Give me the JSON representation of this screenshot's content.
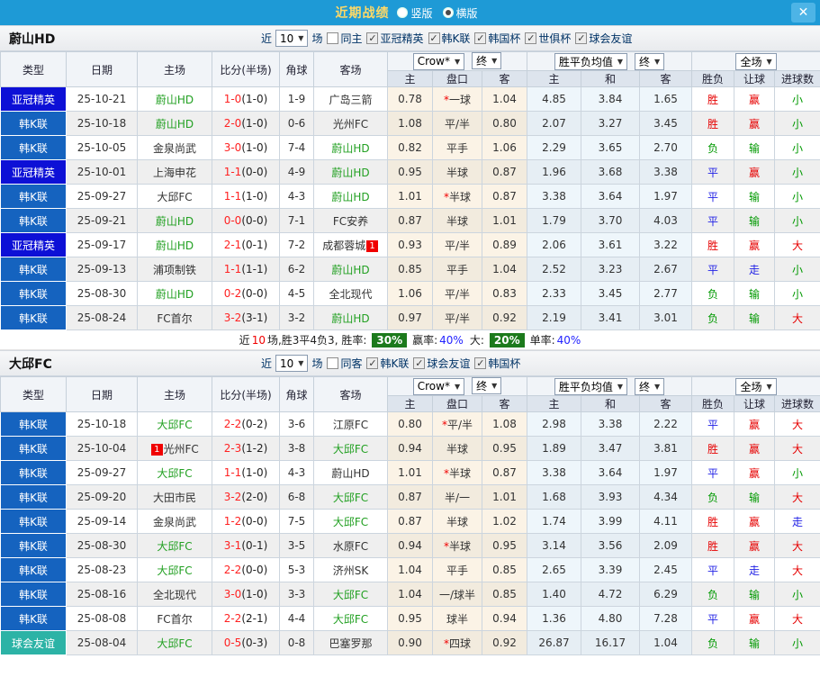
{
  "titlebar": {
    "title": "近期战绩",
    "options": [
      {
        "label": "竖版",
        "selected": false
      },
      {
        "label": "横版",
        "selected": true
      }
    ],
    "close_glyph": "✕"
  },
  "colors": {
    "titlebar_bg": "#1e9ad6",
    "close_btn_bg": "#4db4e6",
    "acl_badge": "#0d10d6",
    "kleague_badge": "#1563bf",
    "friendly_badge": "#2cb3a6",
    "win_red": "#e60000",
    "lose_green": "#009900",
    "draw_blue": "#2222e6",
    "self_team_green": "#22a022",
    "score_red": "#ff2222",
    "summary_badge_green": "#1c7a1c"
  },
  "table_header": {
    "type": "类型",
    "date": "日期",
    "home": "主场",
    "score": "比分(半场)",
    "corner": "角球",
    "away": "客场",
    "odds_source": "Crow*",
    "odds_final": "终",
    "avg_label": "胜平负均值",
    "avg_final": "终",
    "scope": "全场",
    "sub_home": "主",
    "sub_handicap": "盘口",
    "sub_away": "客",
    "sub_avg_home": "主",
    "sub_avg_draw": "和",
    "sub_avg_away": "客",
    "sub_result": "胜负",
    "sub_handicap_result": "让球",
    "sub_goals": "进球数"
  },
  "sections": [
    {
      "team": "蔚山HD",
      "filters": {
        "near": "近",
        "count": "10",
        "games": "场",
        "same": {
          "label": "同主",
          "checked": false
        },
        "leagues": [
          {
            "label": "亚冠精英",
            "checked": true
          },
          {
            "label": "韩K联",
            "checked": true
          },
          {
            "label": "韩国杯",
            "checked": true
          },
          {
            "label": "世俱杯",
            "checked": true
          },
          {
            "label": "球会友谊",
            "checked": true
          }
        ]
      },
      "rows": [
        {
          "league": "亚冠精英",
          "league_color": "acl",
          "date": "25-10-21",
          "home": "蔚山HD",
          "home_is_self": true,
          "home_badge": "",
          "home_badge_pos": "post",
          "score": "1-0",
          "half": "(1-0)",
          "corners": "1-9",
          "away": "广岛三箭",
          "away_is_self": false,
          "away_badge": "",
          "away_badge_pos": "post",
          "odds_home": "0.78",
          "handicap_star": "*",
          "handicap": "一球",
          "odds_away": "1.04",
          "avg_home": "4.85",
          "avg_draw": "3.84",
          "avg_away": "1.65",
          "result": "胜",
          "result_color": "red",
          "handicap_result": "赢",
          "handicap_result_color": "red",
          "goals": "小",
          "goals_color": "green"
        },
        {
          "league": "韩K联",
          "league_color": "kl",
          "date": "25-10-18",
          "home": "蔚山HD",
          "home_is_self": true,
          "home_badge": "",
          "home_badge_pos": "post",
          "score": "2-0",
          "half": "(1-0)",
          "corners": "0-6",
          "away": "光州FC",
          "away_is_self": false,
          "away_badge": "",
          "away_badge_pos": "post",
          "odds_home": "1.08",
          "handicap_star": "",
          "handicap": "平/半",
          "odds_away": "0.80",
          "avg_home": "2.07",
          "avg_draw": "3.27",
          "avg_away": "3.45",
          "result": "胜",
          "result_color": "red",
          "handicap_result": "赢",
          "handicap_result_color": "red",
          "goals": "小",
          "goals_color": "green"
        },
        {
          "league": "韩K联",
          "league_color": "kl",
          "date": "25-10-05",
          "home": "金泉尚武",
          "home_is_self": false,
          "home_badge": "",
          "home_badge_pos": "post",
          "score": "3-0",
          "half": "(1-0)",
          "corners": "7-4",
          "away": "蔚山HD",
          "away_is_self": true,
          "away_badge": "",
          "away_badge_pos": "post",
          "odds_home": "0.82",
          "handicap_star": "",
          "handicap": "平手",
          "odds_away": "1.06",
          "avg_home": "2.29",
          "avg_draw": "3.65",
          "avg_away": "2.70",
          "result": "负",
          "result_color": "green",
          "handicap_result": "输",
          "handicap_result_color": "green",
          "goals": "小",
          "goals_color": "green"
        },
        {
          "league": "亚冠精英",
          "league_color": "acl",
          "date": "25-10-01",
          "home": "上海申花",
          "home_is_self": false,
          "home_badge": "",
          "home_badge_pos": "post",
          "score": "1-1",
          "half": "(0-0)",
          "corners": "4-9",
          "away": "蔚山HD",
          "away_is_self": true,
          "away_badge": "",
          "away_badge_pos": "post",
          "odds_home": "0.95",
          "handicap_star": "",
          "handicap": "半球",
          "odds_away": "0.87",
          "avg_home": "1.96",
          "avg_draw": "3.68",
          "avg_away": "3.38",
          "result": "平",
          "result_color": "blue",
          "handicap_result": "赢",
          "handicap_result_color": "red",
          "goals": "小",
          "goals_color": "green"
        },
        {
          "league": "韩K联",
          "league_color": "kl",
          "date": "25-09-27",
          "home": "大邱FC",
          "home_is_self": false,
          "home_badge": "",
          "home_badge_pos": "post",
          "score": "1-1",
          "half": "(1-0)",
          "corners": "4-3",
          "away": "蔚山HD",
          "away_is_self": true,
          "away_badge": "",
          "away_badge_pos": "post",
          "odds_home": "1.01",
          "handicap_star": "*",
          "handicap": "半球",
          "odds_away": "0.87",
          "avg_home": "3.38",
          "avg_draw": "3.64",
          "avg_away": "1.97",
          "result": "平",
          "result_color": "blue",
          "handicap_result": "输",
          "handicap_result_color": "green",
          "goals": "小",
          "goals_color": "green"
        },
        {
          "league": "韩K联",
          "league_color": "kl",
          "date": "25-09-21",
          "home": "蔚山HD",
          "home_is_self": true,
          "home_badge": "",
          "home_badge_pos": "post",
          "score": "0-0",
          "half": "(0-0)",
          "corners": "7-1",
          "away": "FC安养",
          "away_is_self": false,
          "away_badge": "",
          "away_badge_pos": "post",
          "odds_home": "0.87",
          "handicap_star": "",
          "handicap": "半球",
          "odds_away": "1.01",
          "avg_home": "1.79",
          "avg_draw": "3.70",
          "avg_away": "4.03",
          "result": "平",
          "result_color": "blue",
          "handicap_result": "输",
          "handicap_result_color": "green",
          "goals": "小",
          "goals_color": "green"
        },
        {
          "league": "亚冠精英",
          "league_color": "acl",
          "date": "25-09-17",
          "home": "蔚山HD",
          "home_is_self": true,
          "home_badge": "",
          "home_badge_pos": "post",
          "score": "2-1",
          "half": "(0-1)",
          "corners": "7-2",
          "away": "成都蓉城",
          "away_is_self": false,
          "away_badge": "1",
          "away_badge_pos": "post",
          "odds_home": "0.93",
          "handicap_star": "",
          "handicap": "平/半",
          "odds_away": "0.89",
          "avg_home": "2.06",
          "avg_draw": "3.61",
          "avg_away": "3.22",
          "result": "胜",
          "result_color": "red",
          "handicap_result": "赢",
          "handicap_result_color": "red",
          "goals": "大",
          "goals_color": "red"
        },
        {
          "league": "韩K联",
          "league_color": "kl",
          "date": "25-09-13",
          "home": "浦项制铁",
          "home_is_self": false,
          "home_badge": "",
          "home_badge_pos": "post",
          "score": "1-1",
          "half": "(1-1)",
          "corners": "6-2",
          "away": "蔚山HD",
          "away_is_self": true,
          "away_badge": "",
          "away_badge_pos": "post",
          "odds_home": "0.85",
          "handicap_star": "",
          "handicap": "平手",
          "odds_away": "1.04",
          "avg_home": "2.52",
          "avg_draw": "3.23",
          "avg_away": "2.67",
          "result": "平",
          "result_color": "blue",
          "handicap_result": "走",
          "handicap_result_color": "blue",
          "goals": "小",
          "goals_color": "green"
        },
        {
          "league": "韩K联",
          "league_color": "kl",
          "date": "25-08-30",
          "home": "蔚山HD",
          "home_is_self": true,
          "home_badge": "",
          "home_badge_pos": "post",
          "score": "0-2",
          "half": "(0-0)",
          "corners": "4-5",
          "away": "全北现代",
          "away_is_self": false,
          "away_badge": "",
          "away_badge_pos": "post",
          "odds_home": "1.06",
          "handicap_star": "",
          "handicap": "平/半",
          "odds_away": "0.83",
          "avg_home": "2.33",
          "avg_draw": "3.45",
          "avg_away": "2.77",
          "result": "负",
          "result_color": "green",
          "handicap_result": "输",
          "handicap_result_color": "green",
          "goals": "小",
          "goals_color": "green"
        },
        {
          "league": "韩K联",
          "league_color": "kl",
          "date": "25-08-24",
          "home": "FC首尔",
          "home_is_self": false,
          "home_badge": "",
          "home_badge_pos": "post",
          "score": "3-2",
          "half": "(3-1)",
          "corners": "3-2",
          "away": "蔚山HD",
          "away_is_self": true,
          "away_badge": "",
          "away_badge_pos": "post",
          "odds_home": "0.97",
          "handicap_star": "",
          "handicap": "平/半",
          "odds_away": "0.92",
          "avg_home": "2.19",
          "avg_draw": "3.41",
          "avg_away": "3.01",
          "result": "负",
          "result_color": "green",
          "handicap_result": "输",
          "handicap_result_color": "green",
          "goals": "大",
          "goals_color": "red"
        }
      ],
      "summary": {
        "pre": "近",
        "count": "10",
        "mid": "场,胜3平4负3, 胜率:",
        "rate1": "30%",
        "lab2": "赢率:",
        "rate2": "40%",
        "lab3": "大:",
        "rate3": "20%",
        "lab4": "单率:",
        "rate4": "40%"
      }
    },
    {
      "team": "大邱FC",
      "filters": {
        "near": "近",
        "count": "10",
        "games": "场",
        "same": {
          "label": "同客",
          "checked": false
        },
        "leagues": [
          {
            "label": "韩K联",
            "checked": true
          },
          {
            "label": "球会友谊",
            "checked": true
          },
          {
            "label": "韩国杯",
            "checked": true
          }
        ]
      },
      "rows": [
        {
          "league": "韩K联",
          "league_color": "kl",
          "date": "25-10-18",
          "home": "大邱FC",
          "home_is_self": true,
          "home_badge": "",
          "home_badge_pos": "post",
          "score": "2-2",
          "half": "(0-2)",
          "corners": "3-6",
          "away": "江原FC",
          "away_is_self": false,
          "away_badge": "",
          "away_badge_pos": "post",
          "odds_home": "0.80",
          "handicap_star": "*",
          "handicap": "平/半",
          "odds_away": "1.08",
          "avg_home": "2.98",
          "avg_draw": "3.38",
          "avg_away": "2.22",
          "result": "平",
          "result_color": "blue",
          "handicap_result": "赢",
          "handicap_result_color": "red",
          "goals": "大",
          "goals_color": "red"
        },
        {
          "league": "韩K联",
          "league_color": "kl",
          "date": "25-10-04",
          "home": "光州FC",
          "home_is_self": false,
          "home_badge": "1",
          "home_badge_pos": "pre",
          "score": "2-3",
          "half": "(1-2)",
          "corners": "3-8",
          "away": "大邱FC",
          "away_is_self": true,
          "away_badge": "",
          "away_badge_pos": "post",
          "odds_home": "0.94",
          "handicap_star": "",
          "handicap": "半球",
          "odds_away": "0.95",
          "avg_home": "1.89",
          "avg_draw": "3.47",
          "avg_away": "3.81",
          "result": "胜",
          "result_color": "red",
          "handicap_result": "赢",
          "handicap_result_color": "red",
          "goals": "大",
          "goals_color": "red"
        },
        {
          "league": "韩K联",
          "league_color": "kl",
          "date": "25-09-27",
          "home": "大邱FC",
          "home_is_self": true,
          "home_badge": "",
          "home_badge_pos": "post",
          "score": "1-1",
          "half": "(1-0)",
          "corners": "4-3",
          "away": "蔚山HD",
          "away_is_self": false,
          "away_badge": "",
          "away_badge_pos": "post",
          "odds_home": "1.01",
          "handicap_star": "*",
          "handicap": "半球",
          "odds_away": "0.87",
          "avg_home": "3.38",
          "avg_draw": "3.64",
          "avg_away": "1.97",
          "result": "平",
          "result_color": "blue",
          "handicap_result": "赢",
          "handicap_result_color": "red",
          "goals": "小",
          "goals_color": "green"
        },
        {
          "league": "韩K联",
          "league_color": "kl",
          "date": "25-09-20",
          "home": "大田市民",
          "home_is_self": false,
          "home_badge": "",
          "home_badge_pos": "post",
          "score": "3-2",
          "half": "(2-0)",
          "corners": "6-8",
          "away": "大邱FC",
          "away_is_self": true,
          "away_badge": "",
          "away_badge_pos": "post",
          "odds_home": "0.87",
          "handicap_star": "",
          "handicap": "半/一",
          "odds_away": "1.01",
          "avg_home": "1.68",
          "avg_draw": "3.93",
          "avg_away": "4.34",
          "result": "负",
          "result_color": "green",
          "handicap_result": "输",
          "handicap_result_color": "green",
          "goals": "大",
          "goals_color": "red"
        },
        {
          "league": "韩K联",
          "league_color": "kl",
          "date": "25-09-14",
          "home": "金泉尚武",
          "home_is_self": false,
          "home_badge": "",
          "home_badge_pos": "post",
          "score": "1-2",
          "half": "(0-0)",
          "corners": "7-5",
          "away": "大邱FC",
          "away_is_self": true,
          "away_badge": "",
          "away_badge_pos": "post",
          "odds_home": "0.87",
          "handicap_star": "",
          "handicap": "半球",
          "odds_away": "1.02",
          "avg_home": "1.74",
          "avg_draw": "3.99",
          "avg_away": "4.11",
          "result": "胜",
          "result_color": "red",
          "handicap_result": "赢",
          "handicap_result_color": "red",
          "goals": "走",
          "goals_color": "blue"
        },
        {
          "league": "韩K联",
          "league_color": "kl",
          "date": "25-08-30",
          "home": "大邱FC",
          "home_is_self": true,
          "home_badge": "",
          "home_badge_pos": "post",
          "score": "3-1",
          "half": "(0-1)",
          "corners": "3-5",
          "away": "水原FC",
          "away_is_self": false,
          "away_badge": "",
          "away_badge_pos": "post",
          "odds_home": "0.94",
          "handicap_star": "*",
          "handicap": "半球",
          "odds_away": "0.95",
          "avg_home": "3.14",
          "avg_draw": "3.56",
          "avg_away": "2.09",
          "result": "胜",
          "result_color": "red",
          "handicap_result": "赢",
          "handicap_result_color": "red",
          "goals": "大",
          "goals_color": "red"
        },
        {
          "league": "韩K联",
          "league_color": "kl",
          "date": "25-08-23",
          "home": "大邱FC",
          "home_is_self": true,
          "home_badge": "",
          "home_badge_pos": "post",
          "score": "2-2",
          "half": "(0-0)",
          "corners": "5-3",
          "away": "济州SK",
          "away_is_self": false,
          "away_badge": "",
          "away_badge_pos": "post",
          "odds_home": "1.04",
          "handicap_star": "",
          "handicap": "平手",
          "odds_away": "0.85",
          "avg_home": "2.65",
          "avg_draw": "3.39",
          "avg_away": "2.45",
          "result": "平",
          "result_color": "blue",
          "handicap_result": "走",
          "handicap_result_color": "blue",
          "goals": "大",
          "goals_color": "red"
        },
        {
          "league": "韩K联",
          "league_color": "kl",
          "date": "25-08-16",
          "home": "全北现代",
          "home_is_self": false,
          "home_badge": "",
          "home_badge_pos": "post",
          "score": "3-0",
          "half": "(1-0)",
          "corners": "3-3",
          "away": "大邱FC",
          "away_is_self": true,
          "away_badge": "",
          "away_badge_pos": "post",
          "odds_home": "1.04",
          "handicap_star": "",
          "handicap": "一/球半",
          "odds_away": "0.85",
          "avg_home": "1.40",
          "avg_draw": "4.72",
          "avg_away": "6.29",
          "result": "负",
          "result_color": "green",
          "handicap_result": "输",
          "handicap_result_color": "green",
          "goals": "小",
          "goals_color": "green"
        },
        {
          "league": "韩K联",
          "league_color": "kl",
          "date": "25-08-08",
          "home": "FC首尔",
          "home_is_self": false,
          "home_badge": "",
          "home_badge_pos": "post",
          "score": "2-2",
          "half": "(2-1)",
          "corners": "4-4",
          "away": "大邱FC",
          "away_is_self": true,
          "away_badge": "",
          "away_badge_pos": "post",
          "odds_home": "0.95",
          "handicap_star": "",
          "handicap": "球半",
          "odds_away": "0.94",
          "avg_home": "1.36",
          "avg_draw": "4.80",
          "avg_away": "7.28",
          "result": "平",
          "result_color": "blue",
          "handicap_result": "赢",
          "handicap_result_color": "red",
          "goals": "大",
          "goals_color": "red"
        },
        {
          "league": "球会友谊",
          "league_color": "friendly",
          "date": "25-08-04",
          "home": "大邱FC",
          "home_is_self": true,
          "home_badge": "",
          "home_badge_pos": "post",
          "score": "0-5",
          "half": "(0-3)",
          "corners": "0-8",
          "away": "巴塞罗那",
          "away_is_self": false,
          "away_badge": "",
          "away_badge_pos": "post",
          "odds_home": "0.90",
          "handicap_star": "*",
          "handicap": "四球",
          "odds_away": "0.92",
          "avg_home": "26.87",
          "avg_draw": "16.17",
          "avg_away": "1.04",
          "result": "负",
          "result_color": "green",
          "handicap_result": "输",
          "handicap_result_color": "green",
          "goals": "小",
          "goals_color": "green"
        }
      ],
      "summary": null
    }
  ]
}
